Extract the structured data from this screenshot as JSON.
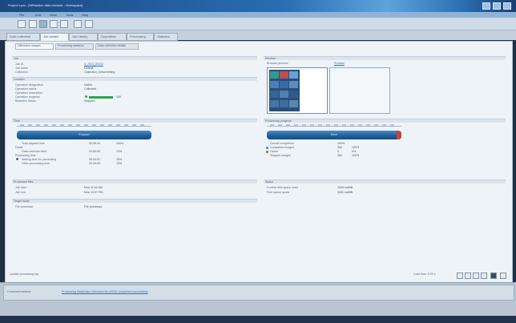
{
  "window": {
    "title": "Project Lynx - [Diffraction data browser - Workspace]"
  },
  "menu": [
    "File",
    "Edit",
    "View",
    "Tools",
    "Help"
  ],
  "tabs": [
    "Data collection",
    "Job details",
    "Job history",
    "Deposition",
    "Processing",
    "Statistics"
  ],
  "subtabs": [
    "Diffraction images",
    "Processing statistics",
    "Data collection details"
  ],
  "job": {
    "section": "Job",
    "id_label": "Job ID",
    "id_value": "d_2013_00342",
    "name_label": "Job name",
    "name_value": "Default",
    "collection_label": "Collection",
    "collection_value": "Collection_03/screening",
    "location_section": "Location",
    "operation_label": "Operation designation",
    "operation_value": "Native",
    "status_label": "Operation status",
    "status_value": "Collected",
    "desc_label": "Operation description",
    "progress_label": "Operation progress",
    "progress_value": "100",
    "progress_fraction": 1.0,
    "beamline_label": "Beamline status",
    "beamline_value": "Stopped"
  },
  "time": {
    "section": "Time",
    "bar_text": "Elapsed",
    "total_label": "Total elapsed time",
    "total_value": "02:35:10",
    "total_extra": "100%",
    "detail_label": "Detail",
    "data_label": "Data collection time",
    "data_value": "01:52:09",
    "data_pct": "72%",
    "process_label": "Processing time",
    "proc1_label": "Waiting time for processing",
    "proc1_value": "00:24:01",
    "proc1_pct": "15%",
    "proc2_label": "Other processing time",
    "proc2_value": "00:19:00",
    "proc2_pct": "13%"
  },
  "processed": {
    "section": "Processed files",
    "a_label": "Job start",
    "a_value": "Mon 11:02 AM",
    "b_label": "Job end",
    "b_value": "Mon 13:37 PM",
    "target_section": "Target hosts",
    "host_label": "File processor",
    "host_value": "File processor"
  },
  "preview": {
    "section": "Preview",
    "label": "Browser preview",
    "link": "Preview"
  },
  "progress": {
    "section": "Processing progress",
    "bar_text": "Done",
    "completion_label": "Overall completion",
    "completion_value": "100%",
    "items": [
      {
        "label": "Completed images",
        "value": "360",
        "pct": "100%",
        "color": "#2f8fd1"
      },
      {
        "label": "Failed",
        "value": "0",
        "pct": "0%",
        "color": "#d24a3a"
      },
      {
        "label": "Skipped images",
        "value": "360",
        "pct": "100%"
      }
    ]
  },
  "disk": {
    "section": "Space",
    "a_label": "Current disk space used",
    "a_value": "1548 sub5B",
    "b_label": "Free space quota",
    "b_value": "3281 sub5B"
  },
  "status": {
    "left": "Update processing log",
    "right": "Load time: 0.52 s"
  },
  "bottom": {
    "label": "Command window",
    "link": "Processing Data/Data Collection/Job #0231 completed successfully"
  },
  "colors": {
    "accent": "#1d5d98",
    "link": "#2f6fb4",
    "ok": "#2fa64a",
    "error": "#c84040"
  }
}
